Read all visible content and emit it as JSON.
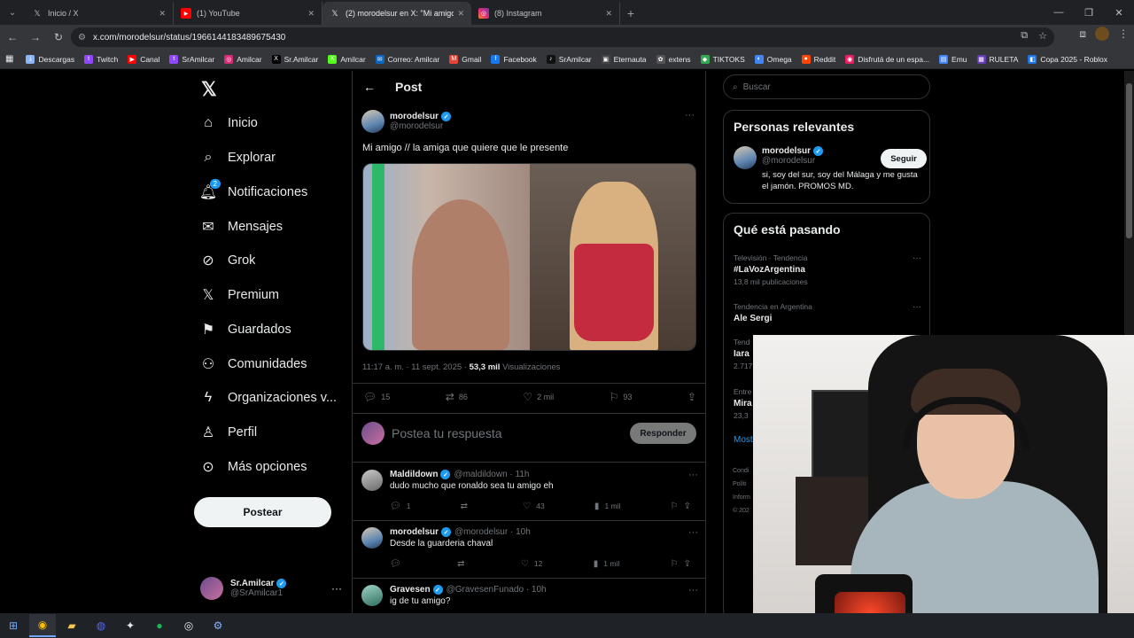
{
  "browser": {
    "tabs": [
      {
        "label": "Inicio / X",
        "icon": "x-icon"
      },
      {
        "label": "(1) YouTube",
        "icon": "youtube-icon"
      },
      {
        "label": "(2) morodelsur en X: \"Mi amigo",
        "icon": "x-icon"
      },
      {
        "label": "(8) Instagram",
        "icon": "instagram-icon"
      }
    ],
    "new_tab": "+",
    "url": "x.com/morodelsur/status/1966144183489675430",
    "bookmarks": [
      {
        "label": "Descargas",
        "color": "#8ab4f8",
        "glyph": "⤓"
      },
      {
        "label": "Twitch",
        "color": "#9146ff",
        "glyph": "t"
      },
      {
        "label": "Canal",
        "color": "#ff0000",
        "glyph": "▶"
      },
      {
        "label": "SrAmilcar",
        "color": "#9146ff",
        "glyph": "t"
      },
      {
        "label": "Amilcar",
        "color": "#d62976",
        "glyph": "◎"
      },
      {
        "label": "Sr.Amilcar",
        "color": "#000000",
        "glyph": "X"
      },
      {
        "label": "Amilcar",
        "color": "#53fc18",
        "glyph": "K"
      },
      {
        "label": "Correo: Amilcar",
        "color": "#0a66c2",
        "glyph": "✉"
      },
      {
        "label": "Gmail",
        "color": "#ea4335",
        "glyph": "M"
      },
      {
        "label": "Facebook",
        "color": "#1877f2",
        "glyph": "f"
      },
      {
        "label": "SrAmilcar",
        "color": "#111111",
        "glyph": "♪"
      },
      {
        "label": "Eternauta",
        "color": "#444444",
        "glyph": "▣"
      },
      {
        "label": "extens",
        "color": "#555555",
        "glyph": "✿"
      },
      {
        "label": "TIKTOKS",
        "color": "#34a853",
        "glyph": "◆"
      },
      {
        "label": "Omega",
        "color": "#4285f4",
        "glyph": "◐"
      },
      {
        "label": "Reddit",
        "color": "#ff4500",
        "glyph": "●"
      },
      {
        "label": "Disfrutá de un espa...",
        "color": "#e91e63",
        "glyph": "◉"
      },
      {
        "label": "Emu",
        "color": "#4285f4",
        "glyph": "▤"
      },
      {
        "label": "RULETA",
        "color": "#673ab7",
        "glyph": "▦"
      },
      {
        "label": "Copa 2025 - Roblox",
        "color": "#1a73e8",
        "glyph": "◧"
      }
    ]
  },
  "nav": {
    "items": [
      {
        "label": "Inicio",
        "icon": "home-icon",
        "glyph": "⌂"
      },
      {
        "label": "Explorar",
        "icon": "search-icon",
        "glyph": "⌕"
      },
      {
        "label": "Notificaciones",
        "icon": "bell-icon",
        "glyph": "🔔︎",
        "badge": "2"
      },
      {
        "label": "Mensajes",
        "icon": "mail-icon",
        "glyph": "✉"
      },
      {
        "label": "Grok",
        "icon": "grok-icon",
        "glyph": "⊘"
      },
      {
        "label": "Premium",
        "icon": "x-premium-icon",
        "glyph": "𝕏"
      },
      {
        "label": "Guardados",
        "icon": "bookmark-icon",
        "glyph": "⚑"
      },
      {
        "label": "Comunidades",
        "icon": "communities-icon",
        "glyph": "⚇"
      },
      {
        "label": "Organizaciones v...",
        "icon": "lightning-icon",
        "glyph": "ϟ"
      },
      {
        "label": "Perfil",
        "icon": "person-icon",
        "glyph": "♙"
      },
      {
        "label": "Más opciones",
        "icon": "more-circle-icon",
        "glyph": "⊙"
      }
    ],
    "post_button": "Postear",
    "account": {
      "name": "Sr.Amilcar",
      "handle": "@SrAmilcar1"
    }
  },
  "post": {
    "header": "Post",
    "author_name": "morodelsur",
    "author_handle": "@morodelsur",
    "text": "Mi amigo // la amiga que quiere que le presente",
    "time": "11:17 a. m. · 11 sept. 2025 ·",
    "views": "53,3 mil",
    "views_label": "Visualizaciones",
    "replies": "15",
    "reposts": "86",
    "likes": "2 mil",
    "bookmarks": "93",
    "reply_placeholder": "Postea tu respuesta",
    "reply_button": "Responder"
  },
  "replies": [
    {
      "name": "Maldildown",
      "handle": "@maldildown · 11h",
      "text": "dudo mucho que ronaldo sea tu amigo eh",
      "replies": "1",
      "reposts": "",
      "likes": "43",
      "views": "1 mil"
    },
    {
      "name": "morodelsur",
      "handle": "@morodelsur · 10h",
      "text": "Desde la guarderia chaval",
      "replies": "",
      "reposts": "",
      "likes": "12",
      "views": "1 mil"
    },
    {
      "name": "Gravesen",
      "handle": "@GravesenFunado · 10h",
      "text": "ig de tu amigo?"
    }
  ],
  "sidebar": {
    "search_placeholder": "Buscar",
    "relevant_title": "Personas relevantes",
    "relevant": {
      "name": "morodelsur",
      "handle": "@morodelsur",
      "bio": "si, soy del sur, soy del Málaga y me gusta el jamón. PROMOS MD.",
      "follow": "Seguir"
    },
    "trending_title": "Qué está pasando",
    "trends": [
      {
        "category": "Televisión · Tendencia",
        "name": "#LaVozArgentina",
        "posts": "13,8 mil publicaciones"
      },
      {
        "category": "Tendencia en Argentina",
        "name": "Ale Sergi",
        "posts": ""
      },
      {
        "category": "Tend",
        "name": "Iara",
        "posts": "2.717"
      },
      {
        "category": "Entre",
        "name": "Mira",
        "posts": "23,3"
      }
    ],
    "more": "Most",
    "footer": [
      "Condi",
      "Políti",
      "Inform",
      "© 202"
    ]
  },
  "colors": {
    "accent": "#1d9bf0",
    "bg": "#000000",
    "border": "#2f3336",
    "muted": "#71767b"
  }
}
